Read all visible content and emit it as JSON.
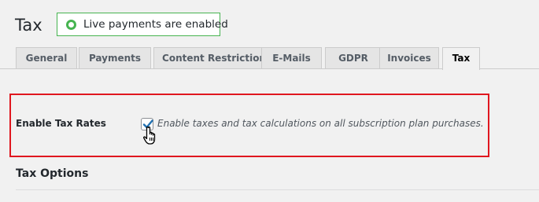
{
  "header": {
    "title": "Tax",
    "status_text": "Live payments are enabled"
  },
  "tabs": [
    {
      "label": "General",
      "active": false
    },
    {
      "label": "Payments",
      "active": false
    },
    {
      "label": "Content Restriction",
      "active": false
    },
    {
      "label": "E-Mails",
      "active": false
    },
    {
      "label": "GDPR",
      "active": false
    },
    {
      "label": "Invoices",
      "active": false
    },
    {
      "label": "Tax",
      "active": true
    }
  ],
  "settings": {
    "enable_tax": {
      "label": "Enable Tax Rates",
      "checked": true,
      "description": "Enable taxes and tax calculations on all subscription plan purchases."
    }
  },
  "section": {
    "title": "Tax Options"
  },
  "colors": {
    "status_green": "#46b450",
    "highlight_red": "#e0171f",
    "check_blue": "#2271b1"
  }
}
